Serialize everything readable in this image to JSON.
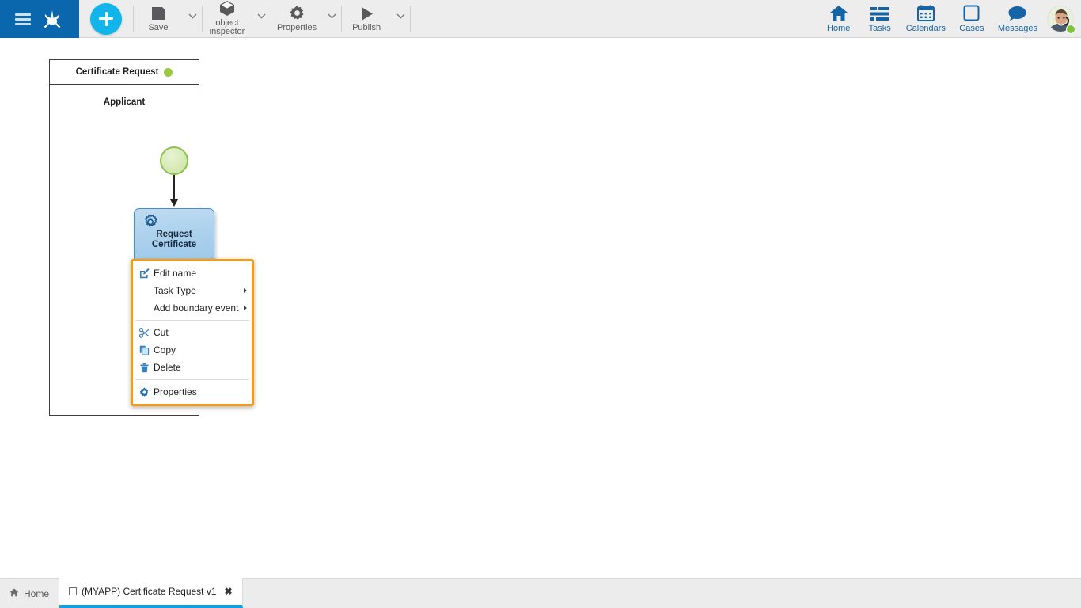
{
  "header": {
    "brand": {
      "menu_icon": "hamburger-menu-icon",
      "logo_icon": "bizagi-crow-logo-icon"
    },
    "create_button": {
      "label": "+",
      "icon": "plus-icon"
    },
    "tools": [
      {
        "label": "Save",
        "icon": "floppy-disk-icon",
        "has_caret": true
      },
      {
        "label": "object\ninspector",
        "icon": "cube-icon",
        "has_caret": true
      },
      {
        "label": "Properties",
        "icon": "gear-icon",
        "has_caret": true
      },
      {
        "label": "Publish",
        "icon": "play-triangle-icon",
        "has_caret": true
      }
    ],
    "nav": [
      {
        "label": "Home",
        "icon": "home-icon"
      },
      {
        "label": "Tasks",
        "icon": "tasks-list-icon"
      },
      {
        "label": "Calendars",
        "icon": "calendar-icon"
      },
      {
        "label": "Cases",
        "icon": "square-outline-icon"
      },
      {
        "label": "Messages",
        "icon": "speech-bubble-icon"
      }
    ],
    "avatar": {
      "name": "user-avatar",
      "status": "online"
    }
  },
  "palette": {
    "items": [
      {
        "name": "pan-move-tool",
        "icon": "four-arrows-move-icon"
      },
      {
        "name": "connector-tool",
        "icon": "arrow-right-circle-icon"
      },
      {
        "name": "start-event-tool",
        "icon": "thin-circle-icon"
      },
      {
        "name": "intermediate-event-tool",
        "icon": "thick-ring-icon"
      },
      {
        "name": "task-tool",
        "icon": "rounded-rectangle-icon"
      },
      {
        "name": "gateway-tool",
        "icon": "diamond-icon"
      },
      {
        "name": "association-tool",
        "icon": "dotted-line-bracket-icon"
      },
      {
        "name": "add-element-tool",
        "icon": "plus-circle-icon"
      }
    ]
  },
  "diagram": {
    "pool_title": "Certificate Request",
    "pool_status": "green",
    "lane_title": "Applicant",
    "start_event": {
      "name": "start-event",
      "type": "none-start"
    },
    "task": {
      "label": "Request\nCertificate",
      "icon": "service-task-gear-icon",
      "selected": true
    },
    "end_event": {
      "name": "end-event",
      "type": "none-end"
    }
  },
  "context_menu": {
    "items": [
      {
        "label": "Edit name",
        "icon": "edit-pencil-icon",
        "submenu": false
      },
      {
        "label": "Task Type",
        "icon": null,
        "submenu": true
      },
      {
        "label": "Add boundary event",
        "icon": null,
        "submenu": true
      },
      {
        "separator": true
      },
      {
        "label": "Cut",
        "icon": "scissors-icon",
        "submenu": false
      },
      {
        "label": "Copy",
        "icon": "copy-pages-icon",
        "submenu": false
      },
      {
        "label": "Delete",
        "icon": "trash-icon",
        "submenu": false
      },
      {
        "separator": true
      },
      {
        "label": "Properties",
        "icon": "gear-icon",
        "submenu": false
      }
    ]
  },
  "bottom_tabs": [
    {
      "label": "Home",
      "icon": "home-small-icon",
      "active": false,
      "closable": false
    },
    {
      "label": "(MYAPP) Certificate Request v1",
      "icon": "document-square-icon",
      "active": true,
      "closable": true,
      "close_label": "✖"
    }
  ],
  "colors": {
    "brand_blue": "#0a66ad",
    "accent_cyan": "#12b5ea",
    "nav_blue": "#1565a6",
    "menu_border_orange": "#f59b15",
    "start_green": "#8cc152",
    "end_red": "#d63b33",
    "task_blue": "#a9cfec",
    "status_green": "#7fc241"
  }
}
